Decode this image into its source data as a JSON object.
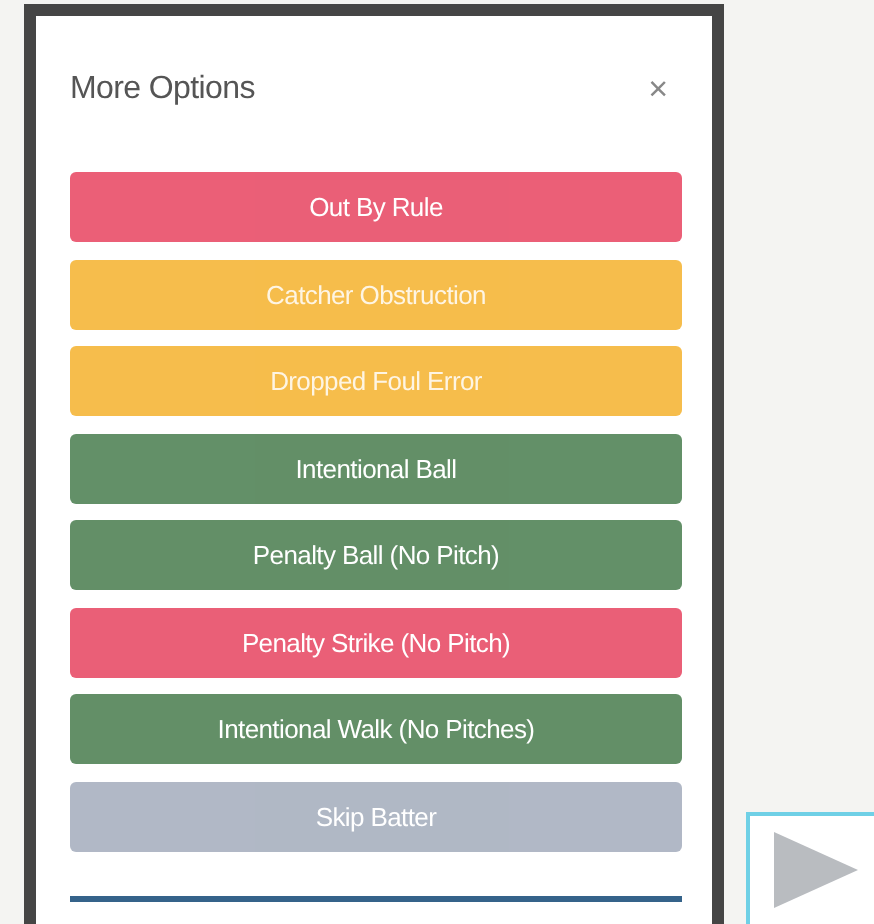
{
  "dialog": {
    "title": "More Options",
    "close": "×",
    "buttons": [
      {
        "label": "Out By Rule",
        "kind": "danger"
      },
      {
        "label": "Catcher Obstruction",
        "kind": "warning"
      },
      {
        "label": "Dropped Foul Error",
        "kind": "warning"
      },
      {
        "label": "Intentional Ball",
        "kind": "success"
      },
      {
        "label": "Penalty Ball (No Pitch)",
        "kind": "success"
      },
      {
        "label": "Penalty Strike (No Pitch)",
        "kind": "danger"
      },
      {
        "label": "Intentional Walk (No Pitches)",
        "kind": "success"
      },
      {
        "label": "Skip Batter",
        "kind": "muted"
      }
    ]
  }
}
